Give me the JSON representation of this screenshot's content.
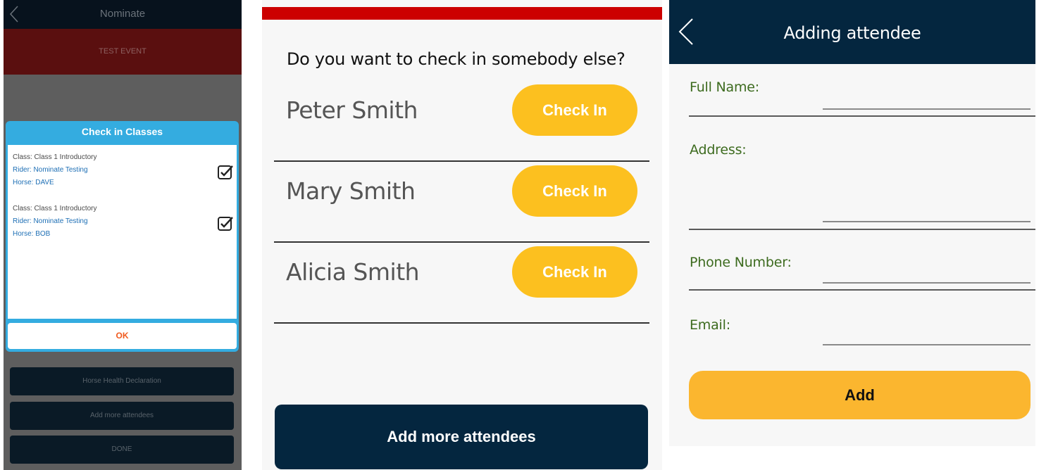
{
  "screen1": {
    "header": {
      "title": "Nominate"
    },
    "event": {
      "name": "TEST EVENT"
    },
    "dialog": {
      "title": "Check in Classes",
      "entries": [
        {
          "class": "Class: Class 1 Introductory",
          "rider": "Rider: Nominate Testing",
          "horse": "Horse: DAVE",
          "checked": true
        },
        {
          "class": "Class: Class 1 Introductory",
          "rider": "Rider: Nominate Testing",
          "horse": "Horse: BOB",
          "checked": true
        }
      ],
      "ok_label": "OK"
    },
    "buttons": {
      "health": "Horse Health Declaration",
      "add_attendees": "Add more attendees",
      "done": "DONE"
    }
  },
  "screen2": {
    "question": "Do you want to check in somebody else?",
    "people": [
      {
        "name": "Peter Smith",
        "button": "Check In"
      },
      {
        "name": "Mary Smith",
        "button": "Check In"
      },
      {
        "name": "Alicia Smith",
        "button": "Check In"
      }
    ],
    "add_label": "Add more attendees"
  },
  "screen3": {
    "header": {
      "title": "Adding attendee"
    },
    "fields": {
      "full_name": {
        "label": "Full Name:",
        "value": ""
      },
      "address": {
        "label": "Address:",
        "value": ""
      },
      "phone": {
        "label": "Phone Number:",
        "value": ""
      },
      "email": {
        "label": "Email:",
        "value": ""
      }
    },
    "add_label": "Add"
  },
  "colors": {
    "navy": "#04263f",
    "accent_yellow": "#fcc01f",
    "dialog_blue": "#34ace0",
    "ok_orange": "#f05a1e",
    "label_green": "#3d6b1f",
    "red_bar": "#cc0000"
  }
}
